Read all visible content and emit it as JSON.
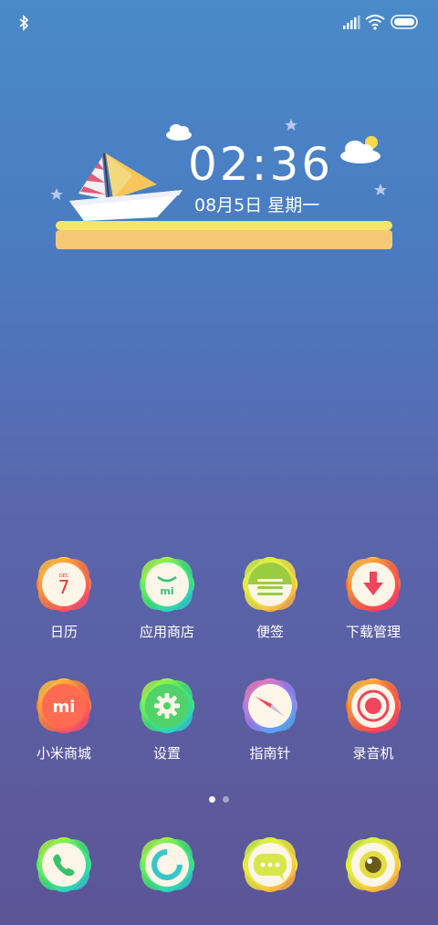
{
  "status_bar": {
    "bluetooth_icon": "bluetooth-icon",
    "signal_icon": "signal-icon",
    "wifi_icon": "wifi-icon",
    "battery_icon": "battery-icon"
  },
  "clock_widget": {
    "time": "02:36",
    "date": "08月5日  星期一"
  },
  "apps_row1": [
    {
      "label": "日历",
      "icon": "calendar-icon",
      "badge_month": "DEC",
      "day": "7"
    },
    {
      "label": "应用商店",
      "icon": "app-store-icon",
      "brand": "mi"
    },
    {
      "label": "便签",
      "icon": "notes-icon"
    },
    {
      "label": "下载管理",
      "icon": "download-icon"
    }
  ],
  "apps_row2": [
    {
      "label": "小米商城",
      "icon": "mi-store-icon",
      "brand": "mi"
    },
    {
      "label": "设置",
      "icon": "settings-icon"
    },
    {
      "label": "指南针",
      "icon": "compass-icon"
    },
    {
      "label": "录音机",
      "icon": "recorder-icon"
    }
  ],
  "page_indicator": {
    "pages": 2,
    "current": 1
  },
  "dock": [
    {
      "icon": "phone-icon"
    },
    {
      "icon": "browser-icon"
    },
    {
      "icon": "messages-icon"
    },
    {
      "icon": "camera-icon"
    }
  ],
  "colors": {
    "orange": "#ff6f3d",
    "green": "#3ddf6e",
    "yellow": "#e5e83a",
    "blue": "#7b8cf5",
    "text": "#ffffff"
  }
}
